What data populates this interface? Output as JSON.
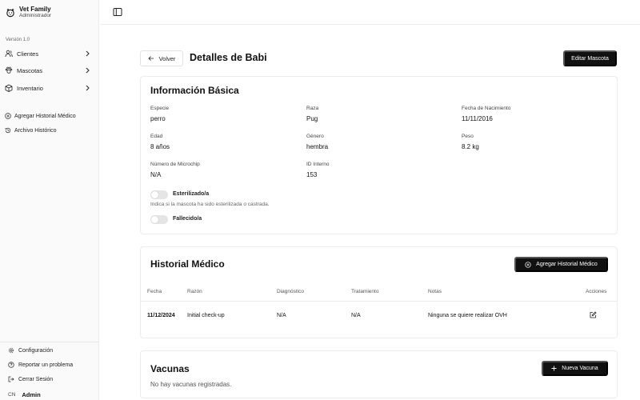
{
  "sidebar": {
    "brand_name": "Vet Family",
    "brand_role": "Administrador",
    "version": "Versión 1.0",
    "main_items": [
      {
        "label": "Clientes",
        "icon": "users-icon"
      },
      {
        "label": "Mascotas",
        "icon": "paw-icon"
      },
      {
        "label": "Inventario",
        "icon": "box-icon"
      }
    ],
    "quick_items": [
      {
        "label": "Agregar Historial Médico",
        "icon": "plus-circle-icon"
      },
      {
        "label": "Archivo Histórico",
        "icon": "history-icon"
      }
    ],
    "footer_items": [
      {
        "label": "Configuración",
        "icon": "gear-icon"
      },
      {
        "label": "Reportar un problema",
        "icon": "help-icon"
      },
      {
        "label": "Cerrar Sesión",
        "icon": "logout-icon"
      }
    ],
    "user_initials": "CN",
    "user_name": "Admin"
  },
  "header": {
    "back_label": "Volver",
    "title": "Detalles de Babi",
    "edit_label": "Editar Mascota"
  },
  "basic_info": {
    "title": "Información Básica",
    "fields": [
      {
        "label": "Especie",
        "value": "perro"
      },
      {
        "label": "Raza",
        "value": "Pug"
      },
      {
        "label": "Fecha de Nacimiento",
        "value": "11/11/2016"
      },
      {
        "label": "Edad",
        "value": "8 años"
      },
      {
        "label": "Género",
        "value": "hembra"
      },
      {
        "label": "Peso",
        "value": "8.2 kg"
      },
      {
        "label": "Número de Microchip",
        "value": "N/A"
      },
      {
        "label": "ID Interno",
        "value": "153"
      }
    ],
    "sterilized_label": "Esterilizado/a",
    "sterilized_help": "Indica si la mascota ha sido esterilizada o castrada.",
    "sterilized_on": false,
    "deceased_label": "Fallecido/a",
    "deceased_on": false
  },
  "medical_history": {
    "title": "Historial Médico",
    "add_label": "Agregar Historial Médico",
    "columns": [
      "Fecha",
      "Razón",
      "Diagnóstico",
      "Tratamiento",
      "Notas",
      "Acciones"
    ],
    "rows": [
      {
        "date": "11/12/2024",
        "reason": "Initial check-up",
        "diagnosis": "N/A",
        "treatment": "N/A",
        "notes": "Ninguna se quiere realizar OVH"
      }
    ]
  },
  "vaccines": {
    "title": "Vacunas",
    "add_label": "Nueva Vacuna",
    "empty_text": "No hay vacunas registradas."
  }
}
